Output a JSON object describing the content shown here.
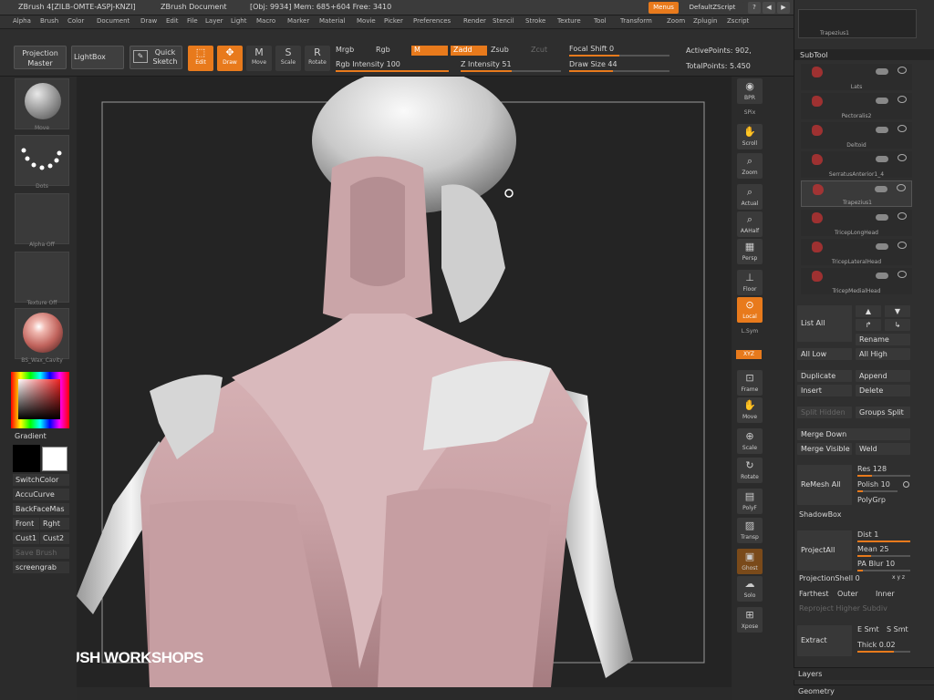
{
  "titlebar": {
    "app": "ZBrush 4[ZILB-OMTE-ASPJ-KNZI]",
    "document": "ZBrush Document",
    "stats": "[Obj: 9934]  Mem: 685+604  Free: 3410",
    "menus_btn": "Menus",
    "script_btn": "DefaultZScript"
  },
  "menubar": [
    "Alpha",
    "Brush",
    "Color",
    "Document",
    "Draw",
    "Edit",
    "File",
    "Layer",
    "Light",
    "Macro",
    "Marker",
    "Material",
    "Movie",
    "Picker",
    "Preferences",
    "Render",
    "Stencil",
    "Stroke",
    "Texture",
    "Tool",
    "Transform",
    "Zoom",
    "Zplugin",
    "Zscript"
  ],
  "shelf": {
    "projection_master": "Projection Master",
    "lightbox": "LightBox",
    "quick_sketch": "Quick Sketch",
    "edit": "Edit",
    "draw": "Draw",
    "move": "Move",
    "scale": "Scale",
    "rotate": "Rotate",
    "mrgb": "Mrgb",
    "rgb": "Rgb",
    "m": "M",
    "zadd": "Zadd",
    "zsub": "Zsub",
    "zcut": "Zcut",
    "rgb_intensity": "Rgb Intensity 100",
    "z_intensity": "Z Intensity 51",
    "focal_shift": "Focal Shift 0",
    "draw_size": "Draw Size 44",
    "active_points": "ActivePoints: 902,",
    "total_points": "TotalPoints: 5.450"
  },
  "sliders": {
    "rgb_intensity": 1.0,
    "z_intensity": 0.51,
    "focal_shift": 0.5,
    "draw_size": 0.44
  },
  "lefttray": {
    "brush": "Move",
    "stroke": "Dots",
    "alpha": "Alpha Off",
    "texture": "Texture Off",
    "material": "BS_Wax_Cavity",
    "gradient": "Gradient",
    "switch_color": "SwitchColor",
    "accucurve": "AccuCurve",
    "backfacemask": "BackFaceMas",
    "front": "Front",
    "right": "Rght",
    "cust1": "Cust1",
    "cust2": "Cust2",
    "save_brush": "Save Brush",
    "screengrab": "screengrab"
  },
  "rightcol": [
    "BPR",
    "SPix",
    "Scroll",
    "Zoom",
    "Actual",
    "AAHalf",
    "Persp",
    "Floor",
    "Local",
    "L.Sym",
    "XYZ",
    "Frame",
    "Move",
    "Scale",
    "Rotate",
    "PolyF",
    "Transp",
    "Ghost",
    "Solo",
    "Xpose"
  ],
  "canvas": {
    "watermark": "ZBRUSH WORKSHOPS"
  },
  "panel": {
    "top_label": "Trapezius1",
    "subtool_title": "SubTool",
    "subtools": [
      "Lats",
      "Pectoralis2",
      "Deltoid",
      "SerratusAnterior1_4",
      "Trapezius1",
      "TricepLongHead",
      "TricepLateralHead",
      "TricepMedialHead"
    ],
    "list_all": "List All",
    "rename": "Rename",
    "all_low": "All Low",
    "all_high": "All High",
    "duplicate": "Duplicate",
    "append": "Append",
    "insert": "Insert",
    "delete": "Delete",
    "split_hidden": "Split Hidden",
    "groups_split": "Groups Split",
    "merge_down": "Merge Down",
    "merge_visible": "Merge Visible",
    "weld": "Weld",
    "remesh_all": "ReMesh All",
    "res": "Res 128",
    "polish": "Polish 10",
    "polygrp": "PolyGrp",
    "shadowbox": "ShadowBox",
    "project_all": "ProjectAll",
    "dist": "Dist 1",
    "mean": "Mean 25",
    "pa_blur": "PA Blur 10",
    "projection_shell": "ProjectionShell 0",
    "farthest": "Farthest",
    "outer": "Outer",
    "inner": "Inner",
    "reproject_higher": "Reproject Higher Subdiv",
    "extract": "Extract",
    "e_smt": "E Smt",
    "s_smt": "S Smt",
    "thick": "Thick 0.02",
    "layers": "Layers",
    "geometry": "Geometry"
  },
  "colors": {
    "accent": "#e87a1c",
    "background": "#2b2b2b",
    "canvas": "#242424"
  }
}
